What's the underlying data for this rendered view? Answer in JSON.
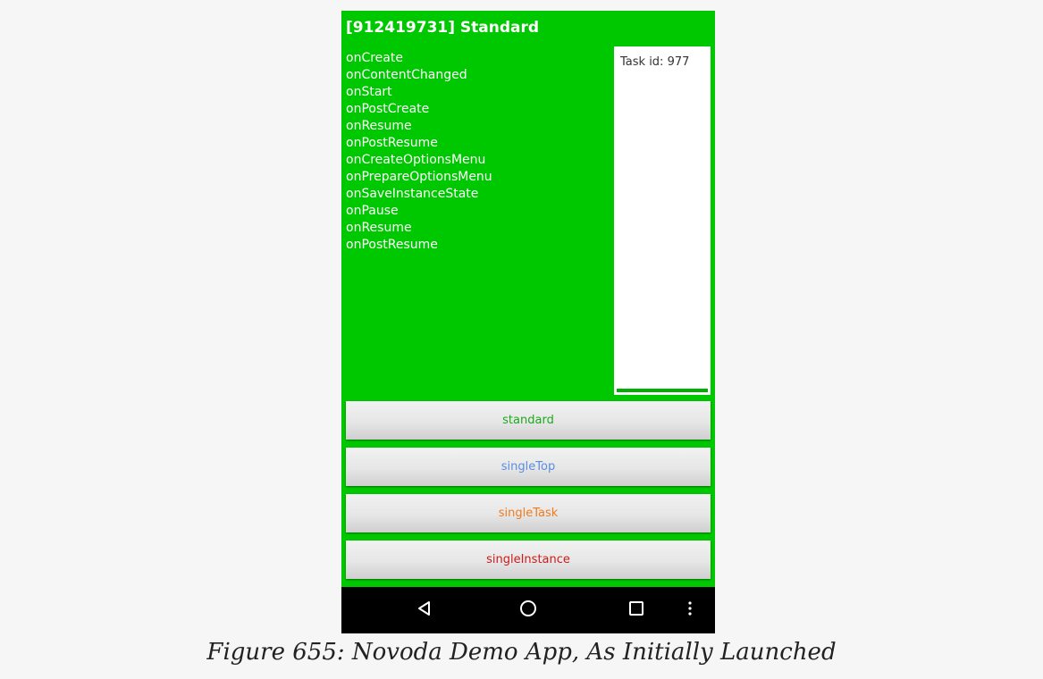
{
  "app": {
    "title": "[912419731] Standard"
  },
  "log": [
    "onCreate",
    "onContentChanged",
    "onStart",
    "onPostCreate",
    "onResume",
    "onPostResume",
    "onCreateOptionsMenu",
    "onPrepareOptionsMenu",
    "onSaveInstanceState",
    "onPause",
    "onResume",
    "onPostResume"
  ],
  "task_panel": {
    "task_id": "Task id: 977"
  },
  "buttons": [
    {
      "label": "standard",
      "color": "#1fa81f"
    },
    {
      "label": "singleTop",
      "color": "#5a8de0"
    },
    {
      "label": "singleTask",
      "color": "#f07a1e"
    },
    {
      "label": "singleInstance",
      "color": "#cc1b1b"
    }
  ],
  "navbar": {
    "icons": [
      "back-icon",
      "home-icon",
      "recents-icon",
      "overflow-menu-icon"
    ]
  },
  "caption": "Figure 655: Novoda Demo App, As Initially Launched",
  "colors": {
    "app_background": "#00c800",
    "navbar": "#000000"
  }
}
